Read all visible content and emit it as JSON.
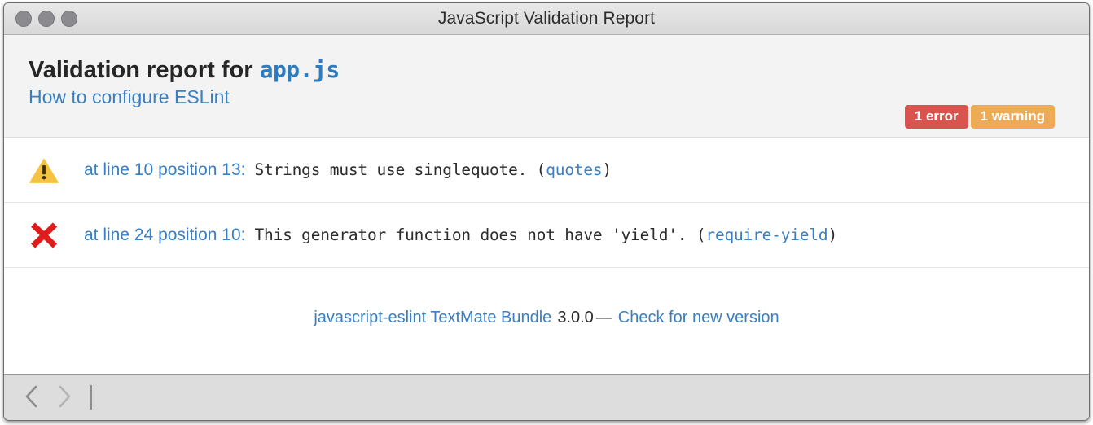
{
  "window": {
    "title": "JavaScript Validation Report",
    "traffic_lights": [
      {
        "name": "close-button",
        "color": "#8b8b8f"
      },
      {
        "name": "minimize-button",
        "color": "#8b8b8f"
      },
      {
        "name": "zoom-button",
        "color": "#8b8b8f"
      }
    ]
  },
  "header": {
    "title_prefix": "Validation report for ",
    "filename": "app.js",
    "configure_link": "How to configure ESLint",
    "badges": [
      {
        "label": "1 error",
        "kind": "error",
        "color": "#d9534f"
      },
      {
        "label": "1 warning",
        "kind": "warning",
        "color": "#eeab55"
      }
    ]
  },
  "issues": [
    {
      "icon": "warning-triangle-icon",
      "severity": "warning",
      "location": "at line 10 position 13:",
      "line": 10,
      "position": 13,
      "message": "Strings must use singlequote. (",
      "rule": "quotes",
      "message_tail": ")"
    },
    {
      "icon": "error-cross-icon",
      "severity": "error",
      "location": "at line 24 position 10:",
      "line": 24,
      "position": 10,
      "message": "This generator function does not have 'yield'. (",
      "rule": "require-yield",
      "message_tail": ")"
    }
  ],
  "footer": {
    "bundle_link": "javascript-eslint TextMate Bundle",
    "version": "3.0.0",
    "separator": "—",
    "update_link": "Check for new version"
  },
  "toolbar": {
    "back_label": "Back",
    "forward_label": "Forward",
    "back_icon": "chevron-left-icon",
    "forward_icon": "chevron-right-icon"
  },
  "colors": {
    "link": "#3a7fc1",
    "warning": "#f5c344",
    "error": "#e01b1b",
    "header_bg": "#f3f3f3",
    "toolbar_bg": "#dddddd"
  }
}
